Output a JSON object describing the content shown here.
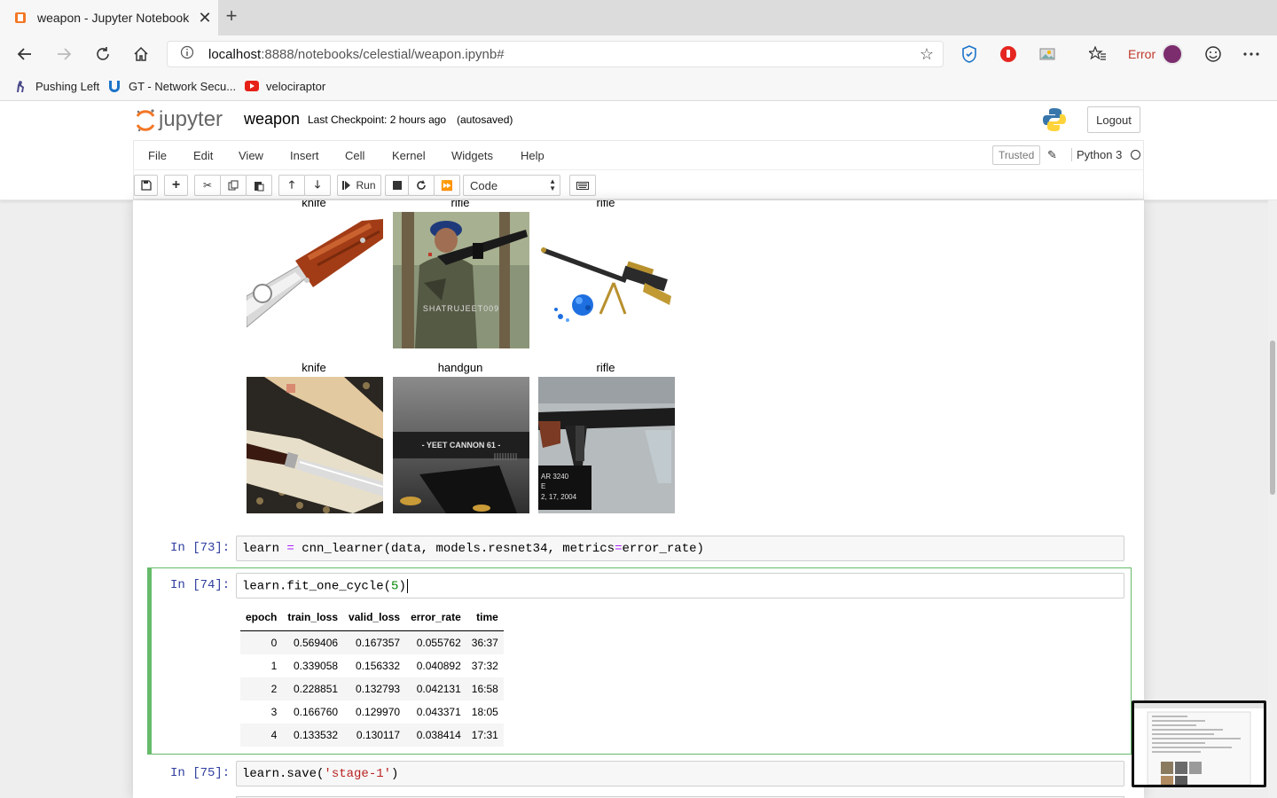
{
  "browser": {
    "tab_title": "weapon - Jupyter Notebook",
    "url_host": "localhost",
    "url_rest": ":8888/notebooks/celestial/weapon.ipynb#",
    "error_label": "Error",
    "bookmarks": [
      {
        "label": "Pushing Left"
      },
      {
        "label": "GT - Network Secu..."
      },
      {
        "label": "velociraptor"
      }
    ]
  },
  "jupyter": {
    "logo_text": "jupyter",
    "notebook_name": "weapon",
    "checkpoint": "Last Checkpoint: 2 hours ago",
    "autosaved": "(autosaved)",
    "logout": "Logout",
    "menu": [
      "File",
      "Edit",
      "View",
      "Insert",
      "Cell",
      "Kernel",
      "Widgets",
      "Help"
    ],
    "trusted": "Trusted",
    "kernel_name": "Python 3",
    "run_label": "Run",
    "cell_type": "Code"
  },
  "images": {
    "row1": [
      "knife",
      "rifle",
      "rifle"
    ],
    "row2": [
      "knife",
      "handgun",
      "rifle"
    ],
    "watermark": "SHATRUJEET009",
    "handgun_text": "- YEET CANNON 61 -",
    "rifle_tag_1": "AR 3240",
    "rifle_tag_2": "E",
    "rifle_tag_3": "2, 17, 2004"
  },
  "cells": {
    "c73": {
      "prompt": "In [73]:",
      "code_a": "learn ",
      "code_eq": "=",
      "code_b": " cnn_learner(data, models.resnet34, metrics",
      "code_eq2": "=",
      "code_c": "error_rate)"
    },
    "c74": {
      "prompt": "In [74]:",
      "code_a": "learn.fit_one_cycle(",
      "code_num": "5",
      "code_b": ")"
    },
    "c75": {
      "prompt": "In [75]:",
      "code_a": "learn.save(",
      "code_str": "'stage-1'",
      "code_b": ")"
    }
  },
  "results": {
    "headers": [
      "epoch",
      "train_loss",
      "valid_loss",
      "error_rate",
      "time"
    ],
    "rows": [
      [
        "0",
        "0.569406",
        "0.167357",
        "0.055762",
        "36:37"
      ],
      [
        "1",
        "0.339058",
        "0.156332",
        "0.040892",
        "37:32"
      ],
      [
        "2",
        "0.228851",
        "0.132793",
        "0.042131",
        "16:58"
      ],
      [
        "3",
        "0.166760",
        "0.129970",
        "0.043371",
        "18:05"
      ],
      [
        "4",
        "0.133532",
        "0.130117",
        "0.038414",
        "17:31"
      ]
    ]
  },
  "colors": {
    "prompt": "#303f9f",
    "selected_border": "#66bb6a",
    "error": "#c0392b"
  }
}
